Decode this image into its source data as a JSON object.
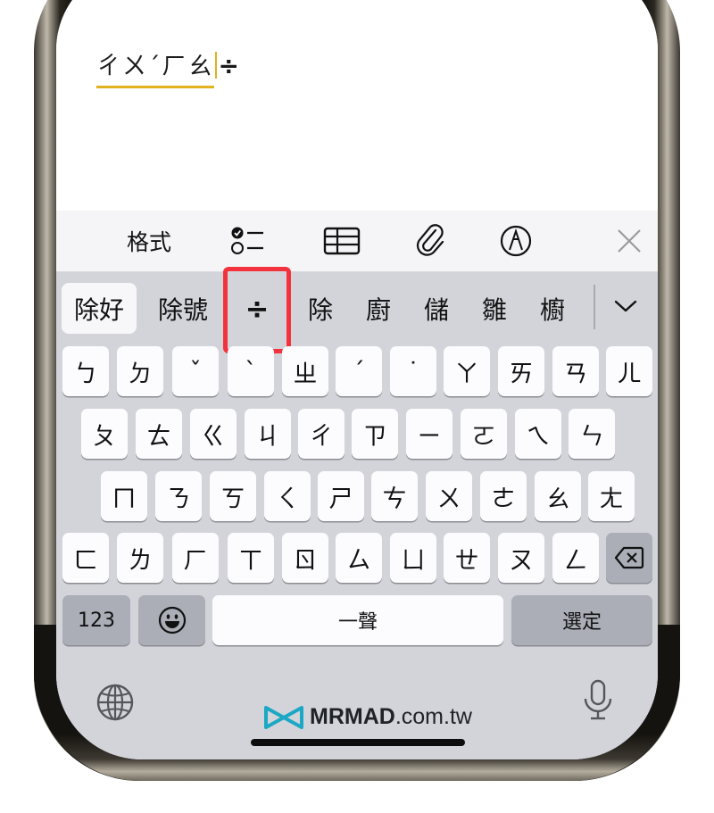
{
  "note": {
    "composing_text": "ㄔㄨˊㄏㄠ",
    "composing_symbol": "÷"
  },
  "toolbar": {
    "format_label": "格式",
    "icons": [
      "checklist-icon",
      "table-icon",
      "paperclip-icon",
      "markup-pen-icon",
      "close-icon"
    ]
  },
  "candidates": {
    "items": [
      "除好",
      "除號",
      "÷",
      "除",
      "廚",
      "儲",
      "雛",
      "櫥"
    ],
    "selected_index": 0,
    "highlighted_index": 2,
    "expand_icon": "chevron-down-icon"
  },
  "keys": {
    "row1": [
      "ㄅ",
      "ㄉ",
      "ˇ",
      "ˋ",
      "ㄓ",
      "ˊ",
      "˙",
      "ㄚ",
      "ㄞ",
      "ㄢ",
      "ㄦ"
    ],
    "row2": [
      "ㄆ",
      "ㄊ",
      "ㄍ",
      "ㄐ",
      "ㄔ",
      "ㄗ",
      "ㄧ",
      "ㄛ",
      "ㄟ",
      "ㄣ"
    ],
    "row3": [
      "ㄇ",
      "ㄋ",
      "ㄎ",
      "ㄑ",
      "ㄕ",
      "ㄘ",
      "ㄨ",
      "ㄜ",
      "ㄠ",
      "ㄤ"
    ],
    "row4": [
      "ㄈ",
      "ㄌ",
      "ㄏ",
      "ㄒ",
      "ㄖ",
      "ㄙ",
      "ㄩ",
      "ㄝ",
      "ㄡ",
      "ㄥ"
    ],
    "numbers_label": "123",
    "space_label": "一聲",
    "confirm_label": "選定",
    "delete_icon": "backspace-icon",
    "emoji_icon": "emoji-icon"
  },
  "bottom": {
    "globe_icon": "globe-icon",
    "mic_icon": "microphone-icon",
    "watermark_brand": "MRMAD",
    "watermark_domain": ".com.tw"
  },
  "colors": {
    "highlight_box": "#f2323d",
    "composing_underline": "#e2b11e",
    "keyboard_bg": "#d3d4da"
  }
}
